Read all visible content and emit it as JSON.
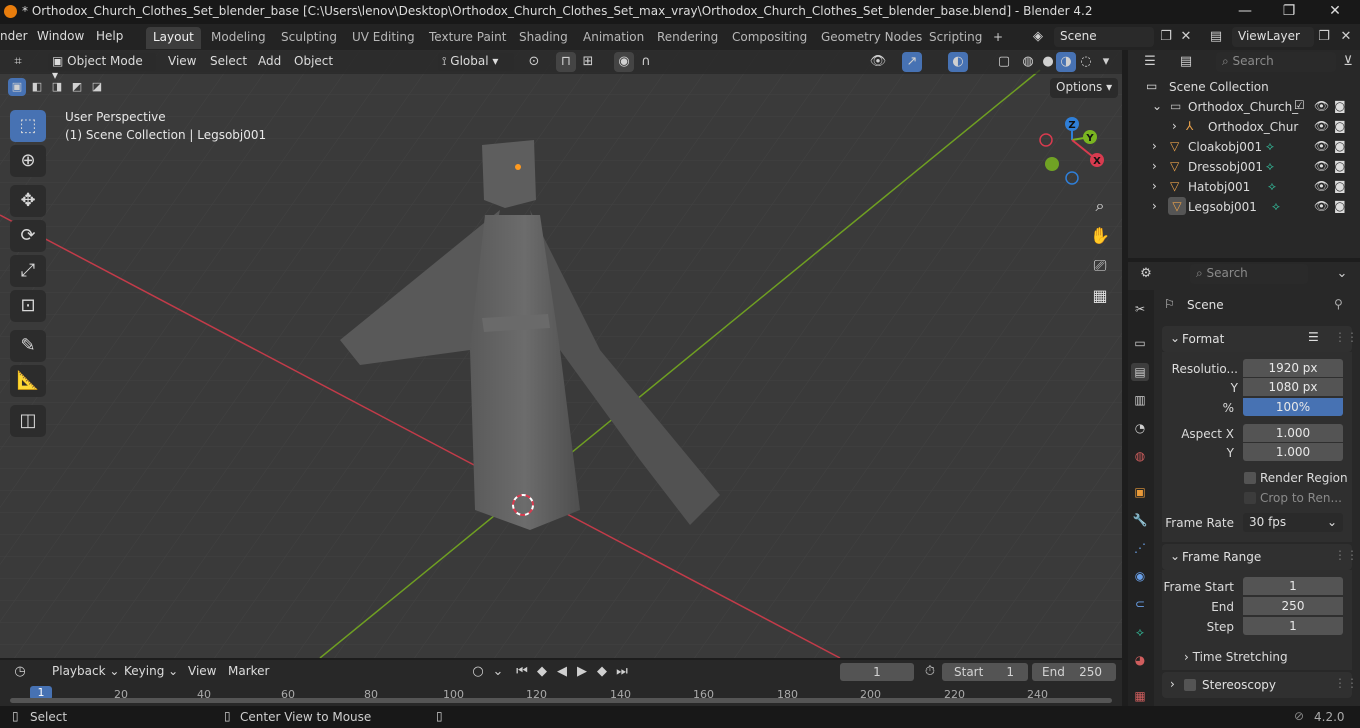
{
  "titlebar": {
    "title": "* Orthodox_Church_Clothes_Set_blender_base [C:\\Users\\lenov\\Desktop\\Orthodox_Church_Clothes_Set_max_vray\\Orthodox_Church_Clothes_Set_blender_base.blend] - Blender 4.2",
    "minimize": "—",
    "restore": "❐",
    "close": "✕"
  },
  "menu": {
    "items": [
      "nder",
      "Window",
      "Help"
    ],
    "workspaces": [
      "Layout",
      "Modeling",
      "Sculpting",
      "UV Editing",
      "Texture Paint",
      "Shading",
      "Animation",
      "Rendering",
      "Compositing",
      "Geometry Nodes",
      "Scripting"
    ],
    "add_tab": "+",
    "scene": "Scene",
    "view_layer": "ViewLayer"
  },
  "viewport": {
    "mode": "Object Mode",
    "menus": [
      "View",
      "Select",
      "Add",
      "Object"
    ],
    "orientation": "Global",
    "options": "Options",
    "perspective": "User Perspective",
    "collection_info": "(1) Scene Collection | Legsobj001",
    "gizmo": {
      "x": "X",
      "y": "Y",
      "z": "Z"
    }
  },
  "outliner": {
    "search_placeholder": "Search",
    "root": "Scene Collection",
    "rows": [
      {
        "label": "Orthodox_Church_"
      },
      {
        "label": "Orthodox_Chur"
      },
      {
        "label": "Cloakobj001"
      },
      {
        "label": "Dressobj001"
      },
      {
        "label": "Hatobj001"
      },
      {
        "label": "Legsobj001"
      }
    ]
  },
  "properties": {
    "search_placeholder": "Search",
    "context": "Scene",
    "format": {
      "header": "Format",
      "resolution_label": "Resolutio...",
      "res_x": "1920 px",
      "y_label": "Y",
      "res_y": "1080 px",
      "pct_label": "%",
      "pct": "100%",
      "aspect_label": "Aspect X",
      "aspect_x": "1.000",
      "aspect_y_label": "Y",
      "aspect_y": "1.000",
      "render_region": "Render Region",
      "crop": "Crop to Ren...",
      "frame_rate_label": "Frame Rate",
      "frame_rate": "30 fps"
    },
    "frame_range": {
      "header": "Frame Range",
      "start_label": "Frame Start",
      "start": "1",
      "end_label": "End",
      "end": "250",
      "step_label": "Step",
      "step": "1"
    },
    "time_stretching": "Time Stretching",
    "stereoscopy": "Stereoscopy"
  },
  "timeline": {
    "menus": [
      "Playback",
      "Keying",
      "View",
      "Marker"
    ],
    "current_frame": "1",
    "start_label": "Start",
    "start": "1",
    "end_label": "End",
    "end": "250",
    "ticks": [
      "1",
      "20",
      "40",
      "60",
      "80",
      "100",
      "120",
      "140",
      "160",
      "180",
      "200",
      "220",
      "240"
    ]
  },
  "status": {
    "select": "Select",
    "center_view": "Center View to Mouse",
    "version": "4.2.0"
  },
  "colors": {
    "accent": "#4772b3",
    "axis_x": "#d83b4f",
    "axis_y": "#7ab521",
    "gizmo_z": "#2f7fd8",
    "blender_orange": "#e87d0d"
  }
}
